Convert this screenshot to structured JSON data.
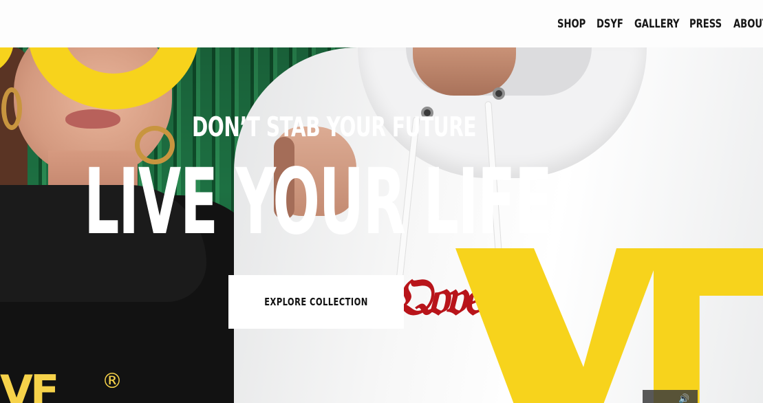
{
  "nav": {
    "items": [
      {
        "label": "SHOP"
      },
      {
        "label": "DSYF"
      },
      {
        "label": "GALLERY"
      },
      {
        "label": "PRESS"
      },
      {
        "label": "ABOUT"
      }
    ]
  },
  "hero": {
    "tagline": "DON’T STAB YOUR FUTURE",
    "headline": "LIVE YOUR LIFE",
    "cta_label": "EXPLORE COLLECTION",
    "left_logo_text": "VF",
    "left_logo_mark": "®",
    "sound_icon": "speaker-icon"
  },
  "colors": {
    "accent_yellow": "#f7d31c",
    "fence_green": "#1d7042",
    "header_bg": "#fdfdfd",
    "cta_bg": "#ffffff",
    "text_white": "#ffffff"
  }
}
